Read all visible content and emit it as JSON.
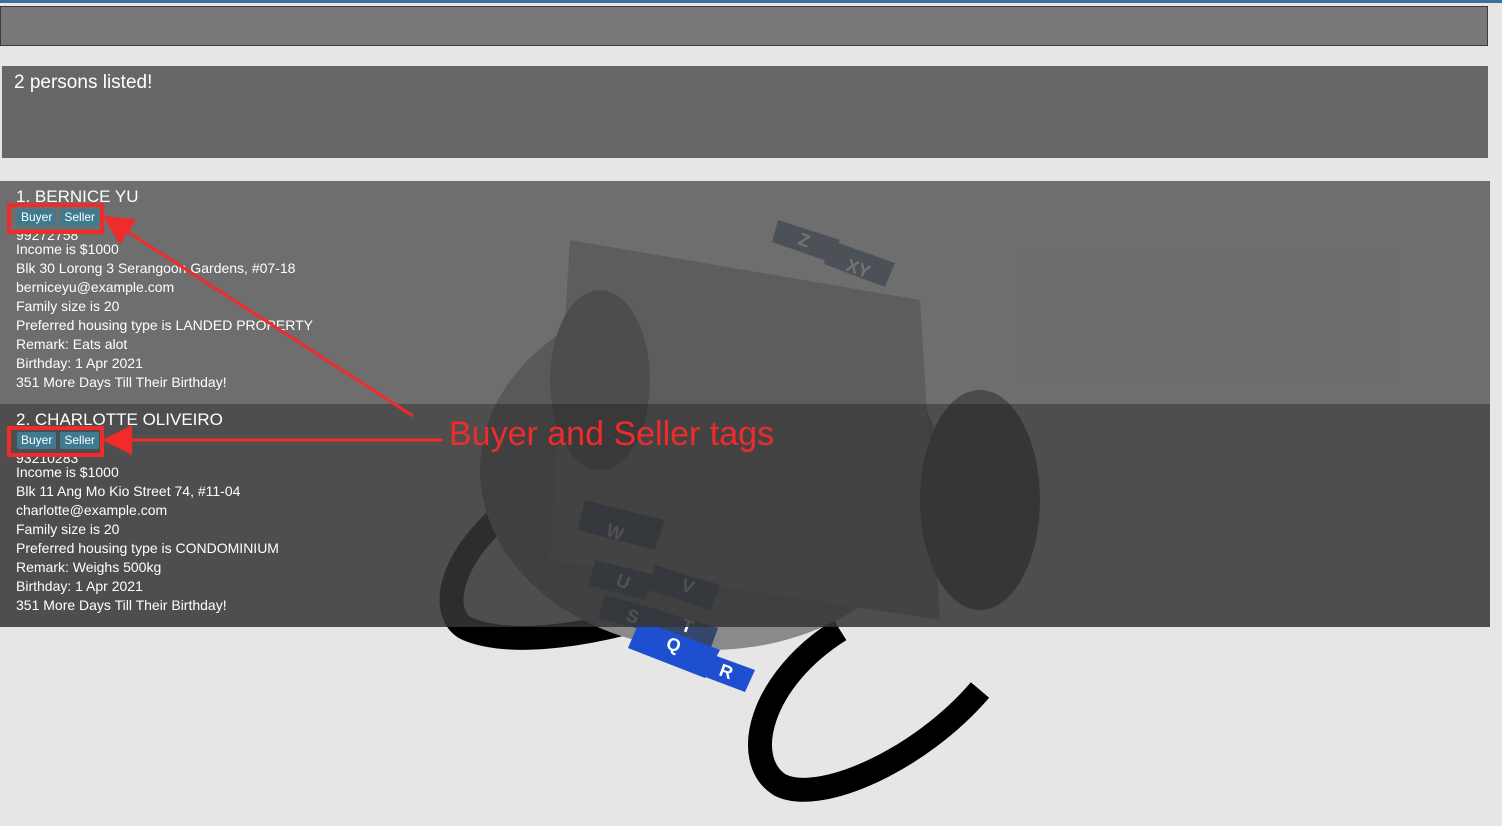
{
  "command_box": {
    "value": ""
  },
  "result_display": {
    "message": "2 persons listed!"
  },
  "persons": [
    {
      "name": "1.  BERNICE YU",
      "tags": [
        "Buyer",
        "Seller"
      ],
      "phone": "99272758",
      "income": "Income is $1000",
      "address": "Blk 30 Lorong 3 Serangoon Gardens, #07-18",
      "email": "berniceyu@example.com",
      "family": "Family size is 20",
      "housing": "Preferred housing type is LANDED PROPERTY",
      "remark": "Remark: Eats alot",
      "birthday": "Birthday: 1 Apr 2021",
      "countdown": "351 More Days Till Their Birthday!"
    },
    {
      "name": "2.  CHARLOTTE OLIVEIRO",
      "tags": [
        "Buyer",
        "Seller"
      ],
      "phone": "93210283",
      "income": "Income is $1000",
      "address": "Blk 11 Ang Mo Kio Street 74, #11-04",
      "email": "charlotte@example.com",
      "family": "Family size is 20",
      "housing": "Preferred housing type is CONDOMINIUM",
      "remark": "Remark: Weighs 500kg",
      "birthday": "Birthday: 1 Apr 2021",
      "countdown": "351 More Days Till Their Birthday!"
    }
  ],
  "rolodex_tabs": [
    "Z",
    "XY",
    "W",
    "U",
    "V",
    "S",
    "T",
    "Q",
    "R"
  ],
  "annotation": {
    "text": "Buyer and Seller tags",
    "color": "#ef2b2b"
  },
  "colors": {
    "tag": "#3e7b91",
    "result_bg": "#676767",
    "command_bg": "#787878"
  },
  "icons": [
    "rolodex-icon"
  ]
}
